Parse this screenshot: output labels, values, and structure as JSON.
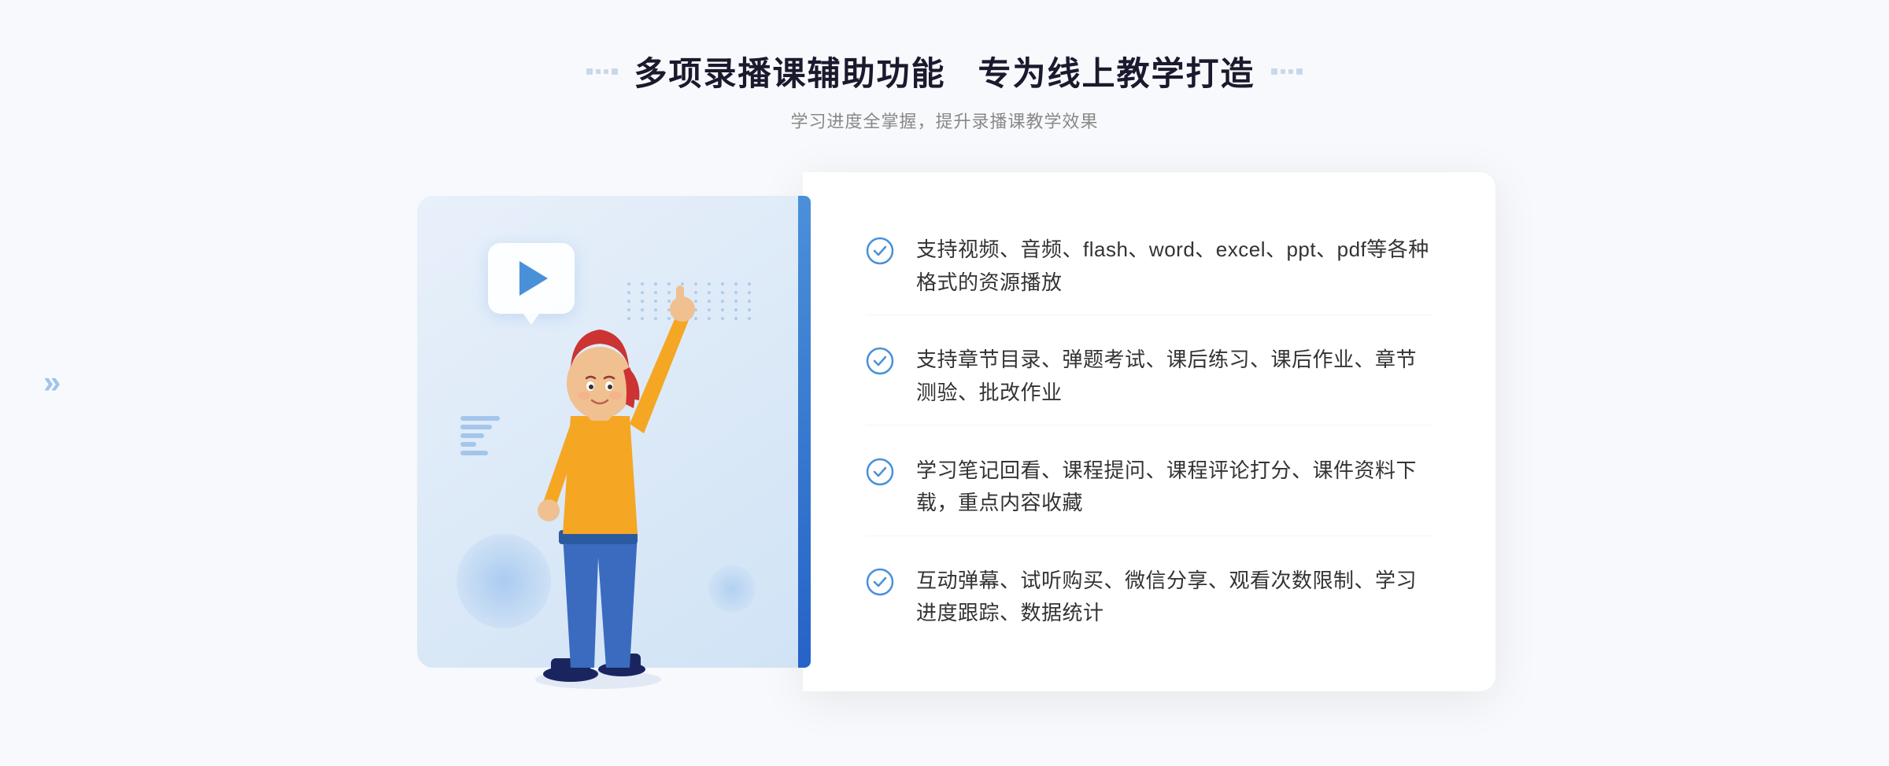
{
  "page": {
    "background": "#f8f9fc"
  },
  "header": {
    "title": "多项录播课辅助功能 专为线上教学打造",
    "subtitle": "学习进度全掌握，提升录播课教学效果",
    "title_part1": "多项录播课辅助功能",
    "title_part2": "专为线上教学打造"
  },
  "features": [
    {
      "id": 1,
      "text": "支持视频、音频、flash、word、excel、ppt、pdf等各种格式的资源播放"
    },
    {
      "id": 2,
      "text": "支持章节目录、弹题考试、课后练习、课后作业、章节测验、批改作业"
    },
    {
      "id": 3,
      "text": "学习笔记回看、课程提问、课程评论打分、课件资料下载，重点内容收藏"
    },
    {
      "id": 4,
      "text": "互动弹幕、试听购买、微信分享、观看次数限制、学习进度跟踪、数据统计"
    }
  ],
  "decoration": {
    "chevron_symbol": "»",
    "play_button_aria": "play-button"
  }
}
